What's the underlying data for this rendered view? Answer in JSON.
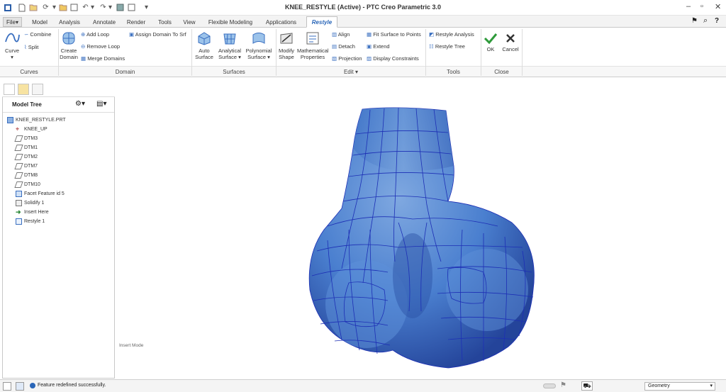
{
  "window": {
    "title": "KNEE_RESTYLE (Active) - PTC Creo Parametric 3.0"
  },
  "tabs": [
    "File",
    "Model",
    "Analysis",
    "Annotate",
    "Render",
    "Tools",
    "View",
    "Flexible Modeling",
    "Applications",
    "Restyle"
  ],
  "active_tab": "Restyle",
  "ribbon": {
    "curves": {
      "curve": "Curve",
      "combine": "Combine",
      "split": "Split",
      "group": "Curves"
    },
    "domain": {
      "create_domain_1": "Create",
      "create_domain_2": "Domain",
      "add_loop": "Add Loop",
      "remove_loop": "Remove Loop",
      "merge_domains": "Merge Domains",
      "assign_domain": "Assign Domain To Srf",
      "group": "Domain"
    },
    "surfaces": {
      "auto_1": "Auto",
      "auto_2": "Surface",
      "analytical_1": "Analytical",
      "analytical_2": "Surface",
      "polynomial_1": "Polynomial",
      "polynomial_2": "Surface",
      "group": "Surfaces"
    },
    "edit": {
      "modify_1": "Modify",
      "modify_2": "Shape",
      "math_1": "Mathematical",
      "math_2": "Properties",
      "align": "Align",
      "detach": "Detach",
      "projection": "Projection",
      "fit_surface": "Fit Surface to Points",
      "extend": "Extend",
      "display_constraints": "Display Constraints",
      "group": "Edit"
    },
    "tools": {
      "restyle_analysis": "Restyle Analysis",
      "restyle_tree": "Restyle Tree",
      "group": "Tools"
    },
    "close": {
      "ok": "OK",
      "cancel": "Cancel",
      "group": "Close"
    }
  },
  "model_tree": {
    "title": "Model Tree",
    "items": [
      "KNEE_RESTYLE.PRT",
      "KNEE_UP",
      "DTM3",
      "DTM1",
      "DTM2",
      "DTM7",
      "DTM8",
      "DTM10",
      "Facet Feature id 5",
      "Solidify 1",
      "Insert Here",
      "Restyle 1"
    ]
  },
  "canvas": {
    "mode_label": "Insert Mode"
  },
  "status": {
    "message": "Feature redefined successfully.",
    "filter": "Geometry"
  },
  "colors": {
    "accent": "#2a66b8",
    "model": "#4a7fcf",
    "mesh": "#1d2fb5",
    "ok": "#2e9a3a"
  }
}
